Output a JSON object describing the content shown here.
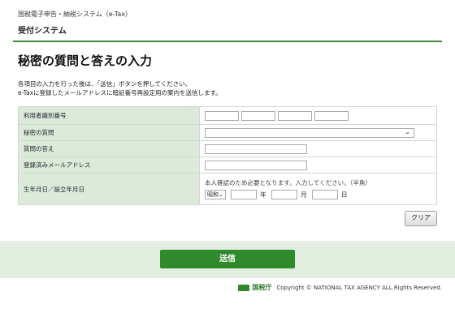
{
  "header": {
    "system_name": "国税電子申告・納税システム（e-Tax）",
    "sub_system": "受付システム"
  },
  "page": {
    "title": "秘密の質問と答えの入力",
    "instructions": [
      "各項目の入力を行った後は、「送信」ボタンを押してください。",
      "e-Taxに登録したメールアドレスに暗証番号再設定用の案内を送信します。"
    ]
  },
  "form": {
    "user_id_label": "利用者識別番号",
    "question_label": "秘密の質問",
    "answer_label": "質問の答え",
    "email_label": "登録済みメールアドレス",
    "dob_label": "生年月日／設立年月日",
    "dob_note": "本人確認のため必要となります。入力してください。（半角）",
    "era_selected": "昭和",
    "year_unit": "年",
    "month_unit": "月",
    "day_unit": "日"
  },
  "buttons": {
    "clear": "クリア",
    "submit": "送信"
  },
  "footer": {
    "agency": "国税庁",
    "copyright": "Copyright © NATIONAL TAX AGENCY ALL Rights Reserved."
  },
  "colors": {
    "accent_green": "#2e8a2a",
    "label_bg": "#dcebd9",
    "band_bg": "#e2eedf"
  }
}
